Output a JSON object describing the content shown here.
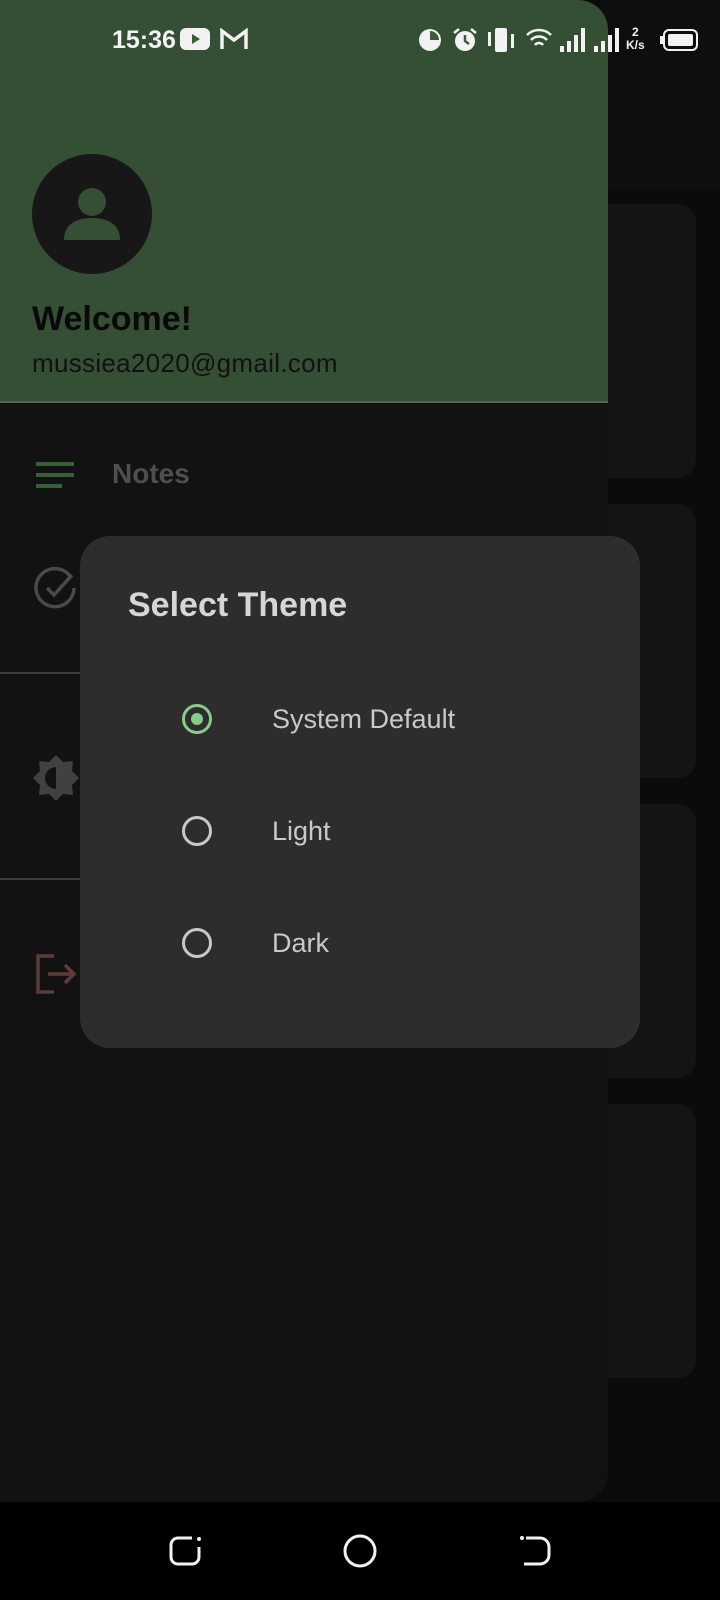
{
  "status_bar": {
    "time": "15:36",
    "network_speed_value": "2",
    "network_speed_unit": "K/s",
    "icons": [
      "youtube-icon",
      "gmail-icon",
      "data-saver-icon",
      "alarm-icon",
      "vibrate-icon",
      "wifi-icon",
      "signal-icon",
      "signal-icon",
      "battery-icon"
    ]
  },
  "drawer": {
    "welcome": "Welcome!",
    "email": "mussiea2020@gmail.com",
    "items": [
      {
        "label": "Notes",
        "icon": "menu-lines-icon"
      },
      {
        "label": "",
        "icon": "check-circle-icon"
      },
      {
        "label": "",
        "icon": "brightness-icon"
      },
      {
        "label": "",
        "icon": "logout-icon"
      }
    ],
    "accent": "#3c5b3c"
  },
  "dialog": {
    "title": "Select Theme",
    "options": [
      {
        "label": "System Default",
        "selected": true
      },
      {
        "label": "Light",
        "selected": false
      },
      {
        "label": "Dark",
        "selected": false
      }
    ],
    "accent": "#86cc86"
  },
  "nav_bar": {
    "buttons": [
      "recents-icon",
      "home-icon",
      "back-icon"
    ]
  }
}
